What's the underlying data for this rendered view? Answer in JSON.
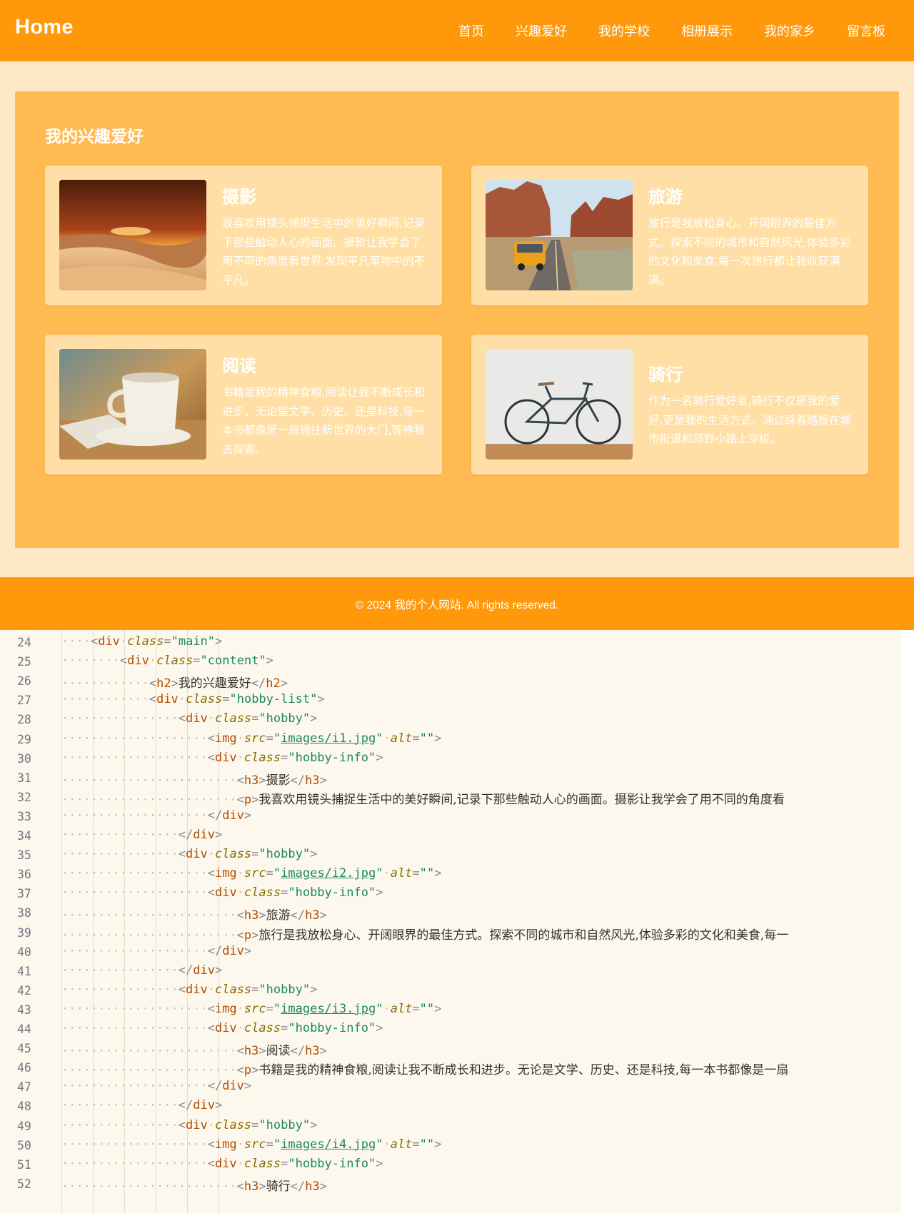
{
  "site": {
    "logo": "Home",
    "nav": [
      "首页",
      "兴趣爱好",
      "我的学校",
      "相册展示",
      "我的家乡",
      "留言板"
    ],
    "section_title": "我的兴趣爱好",
    "hobbies": [
      {
        "title": "摄影",
        "desc": "我喜欢用镜头捕捉生活中的美好瞬间,记录下那些触动人心的画面。摄影让我学会了用不同的角度看世界,发现平凡事物中的不平凡。",
        "image": "desert-sunset-photo"
      },
      {
        "title": "旅游",
        "desc": "旅行是我放松身心、开阔眼界的最佳方式。探索不同的城市和自然风光,体验多彩的文化和美食,每一次旅行都让我收获满满。",
        "image": "canyon-road-van-photo"
      },
      {
        "title": "阅读",
        "desc": "书籍是我的精神食粮,阅读让我不断成长和进步。无论是文学、历史、还是科技,每一本书都像是一扇通往新世界的大门,等待我去探索。",
        "image": "coffee-cup-photo"
      },
      {
        "title": "骑行",
        "desc": "作为一名骑行爱好者,骑行不仅是我的爱好,更是我的生活方式。通过踩着踏板在城市街道和郊野小路上穿梭。",
        "image": "bicycle-wall-photo"
      }
    ],
    "footer": "© 2024 我的个人网站. All rights reserved.",
    "colors": {
      "primary": "#ff980a",
      "panel": "#ffba52",
      "card": "#ffdfa5",
      "background": "#ffe9c4"
    }
  },
  "code": {
    "lines": [
      {
        "n": "24",
        "indent": 1,
        "tokens": [
          [
            "br",
            "<"
          ],
          [
            "tg",
            "div"
          ],
          [
            "ws",
            "·"
          ],
          [
            "at",
            "class"
          ],
          [
            "br",
            "="
          ],
          [
            "st",
            "\"main\""
          ],
          [
            "br",
            ">"
          ]
        ]
      },
      {
        "n": "25",
        "indent": 2,
        "tokens": [
          [
            "br",
            "<"
          ],
          [
            "tg",
            "div"
          ],
          [
            "ws",
            "·"
          ],
          [
            "at",
            "class"
          ],
          [
            "br",
            "="
          ],
          [
            "st",
            "\"content\""
          ],
          [
            "br",
            ">"
          ]
        ]
      },
      {
        "n": "26",
        "indent": 3,
        "tokens": [
          [
            "br",
            "<"
          ],
          [
            "tg",
            "h2"
          ],
          [
            "br",
            ">"
          ],
          [
            "tx",
            "我的兴趣爱好"
          ],
          [
            "br",
            "</"
          ],
          [
            "tg",
            "h2"
          ],
          [
            "br",
            ">"
          ]
        ]
      },
      {
        "n": "27",
        "indent": 3,
        "tokens": [
          [
            "br",
            "<"
          ],
          [
            "tg",
            "div"
          ],
          [
            "ws",
            "·"
          ],
          [
            "at",
            "class"
          ],
          [
            "br",
            "="
          ],
          [
            "st",
            "\"hobby-list\""
          ],
          [
            "br",
            ">"
          ]
        ]
      },
      {
        "n": "28",
        "indent": 4,
        "tokens": [
          [
            "br",
            "<"
          ],
          [
            "tg",
            "div"
          ],
          [
            "ws",
            "·"
          ],
          [
            "at",
            "class"
          ],
          [
            "br",
            "="
          ],
          [
            "st",
            "\"hobby\""
          ],
          [
            "br",
            ">"
          ]
        ]
      },
      {
        "n": "29",
        "indent": 5,
        "tokens": [
          [
            "br",
            "<"
          ],
          [
            "tg",
            "img"
          ],
          [
            "ws",
            "·"
          ],
          [
            "at",
            "src"
          ],
          [
            "br",
            "="
          ],
          [
            "st",
            "\""
          ],
          [
            "lk",
            "images/i1.jpg"
          ],
          [
            "st",
            "\""
          ],
          [
            "ws",
            "·"
          ],
          [
            "at",
            "alt"
          ],
          [
            "br",
            "="
          ],
          [
            "st",
            "\"\""
          ],
          [
            "br",
            ">"
          ]
        ]
      },
      {
        "n": "30",
        "indent": 5,
        "tokens": [
          [
            "br",
            "<"
          ],
          [
            "tg",
            "div"
          ],
          [
            "ws",
            "·"
          ],
          [
            "at",
            "class"
          ],
          [
            "br",
            "="
          ],
          [
            "st",
            "\"hobby-info\""
          ],
          [
            "br",
            ">"
          ]
        ]
      },
      {
        "n": "31",
        "indent": 6,
        "tokens": [
          [
            "br",
            "<"
          ],
          [
            "tg",
            "h3"
          ],
          [
            "br",
            ">"
          ],
          [
            "tx",
            "摄影"
          ],
          [
            "br",
            "</"
          ],
          [
            "tg",
            "h3"
          ],
          [
            "br",
            ">"
          ]
        ]
      },
      {
        "n": "32",
        "indent": 6,
        "tokens": [
          [
            "br",
            "<"
          ],
          [
            "tg",
            "p"
          ],
          [
            "br",
            ">"
          ],
          [
            "tx",
            "我喜欢用镜头捕捉生活中的美好瞬间,记录下那些触动人心的画面。摄影让我学会了用不同的角度看"
          ]
        ]
      },
      {
        "n": "33",
        "indent": 5,
        "tokens": [
          [
            "br",
            "</"
          ],
          [
            "tg",
            "div"
          ],
          [
            "br",
            ">"
          ]
        ]
      },
      {
        "n": "34",
        "indent": 4,
        "tokens": [
          [
            "br",
            "</"
          ],
          [
            "tg",
            "div"
          ],
          [
            "br",
            ">"
          ]
        ]
      },
      {
        "n": "35",
        "indent": 4,
        "tokens": [
          [
            "br",
            "<"
          ],
          [
            "tg",
            "div"
          ],
          [
            "ws",
            "·"
          ],
          [
            "at",
            "class"
          ],
          [
            "br",
            "="
          ],
          [
            "st",
            "\"hobby\""
          ],
          [
            "br",
            ">"
          ]
        ]
      },
      {
        "n": "36",
        "indent": 5,
        "tokens": [
          [
            "br",
            "<"
          ],
          [
            "tg",
            "img"
          ],
          [
            "ws",
            "·"
          ],
          [
            "at",
            "src"
          ],
          [
            "br",
            "="
          ],
          [
            "st",
            "\""
          ],
          [
            "lk",
            "images/i2.jpg"
          ],
          [
            "st",
            "\""
          ],
          [
            "ws",
            "·"
          ],
          [
            "at",
            "alt"
          ],
          [
            "br",
            "="
          ],
          [
            "st",
            "\"\""
          ],
          [
            "br",
            ">"
          ]
        ]
      },
      {
        "n": "37",
        "indent": 5,
        "tokens": [
          [
            "br",
            "<"
          ],
          [
            "tg",
            "div"
          ],
          [
            "ws",
            "·"
          ],
          [
            "at",
            "class"
          ],
          [
            "br",
            "="
          ],
          [
            "st",
            "\"hobby-info\""
          ],
          [
            "br",
            ">"
          ]
        ]
      },
      {
        "n": "38",
        "indent": 6,
        "tokens": [
          [
            "br",
            "<"
          ],
          [
            "tg",
            "h3"
          ],
          [
            "br",
            ">"
          ],
          [
            "tx",
            "旅游"
          ],
          [
            "br",
            "</"
          ],
          [
            "tg",
            "h3"
          ],
          [
            "br",
            ">"
          ]
        ]
      },
      {
        "n": "39",
        "indent": 6,
        "tokens": [
          [
            "br",
            "<"
          ],
          [
            "tg",
            "p"
          ],
          [
            "br",
            ">"
          ],
          [
            "tx",
            "旅行是我放松身心、开阔眼界的最佳方式。探索不同的城市和自然风光,体验多彩的文化和美食,每一"
          ]
        ]
      },
      {
        "n": "40",
        "indent": 5,
        "tokens": [
          [
            "br",
            "</"
          ],
          [
            "tg",
            "div"
          ],
          [
            "br",
            ">"
          ]
        ]
      },
      {
        "n": "41",
        "indent": 4,
        "tokens": [
          [
            "br",
            "</"
          ],
          [
            "tg",
            "div"
          ],
          [
            "br",
            ">"
          ]
        ]
      },
      {
        "n": "42",
        "indent": 4,
        "tokens": [
          [
            "br",
            "<"
          ],
          [
            "tg",
            "div"
          ],
          [
            "ws",
            "·"
          ],
          [
            "at",
            "class"
          ],
          [
            "br",
            "="
          ],
          [
            "st",
            "\"hobby\""
          ],
          [
            "br",
            ">"
          ]
        ]
      },
      {
        "n": "43",
        "indent": 5,
        "tokens": [
          [
            "br",
            "<"
          ],
          [
            "tg",
            "img"
          ],
          [
            "ws",
            "·"
          ],
          [
            "at",
            "src"
          ],
          [
            "br",
            "="
          ],
          [
            "st",
            "\""
          ],
          [
            "lk",
            "images/i3.jpg"
          ],
          [
            "st",
            "\""
          ],
          [
            "ws",
            "·"
          ],
          [
            "at",
            "alt"
          ],
          [
            "br",
            "="
          ],
          [
            "st",
            "\"\""
          ],
          [
            "br",
            ">"
          ]
        ]
      },
      {
        "n": "44",
        "indent": 5,
        "tokens": [
          [
            "br",
            "<"
          ],
          [
            "tg",
            "div"
          ],
          [
            "ws",
            "·"
          ],
          [
            "at",
            "class"
          ],
          [
            "br",
            "="
          ],
          [
            "st",
            "\"hobby-info\""
          ],
          [
            "br",
            ">"
          ]
        ]
      },
      {
        "n": "45",
        "indent": 6,
        "tokens": [
          [
            "br",
            "<"
          ],
          [
            "tg",
            "h3"
          ],
          [
            "br",
            ">"
          ],
          [
            "tx",
            "阅读"
          ],
          [
            "br",
            "</"
          ],
          [
            "tg",
            "h3"
          ],
          [
            "br",
            ">"
          ]
        ]
      },
      {
        "n": "46",
        "indent": 6,
        "tokens": [
          [
            "br",
            "<"
          ],
          [
            "tg",
            "p"
          ],
          [
            "br",
            ">"
          ],
          [
            "tx",
            "书籍是我的精神食粮,阅读让我不断成长和进步。无论是文学、历史、还是科技,每一本书都像是一扇"
          ]
        ]
      },
      {
        "n": "47",
        "indent": 5,
        "tokens": [
          [
            "br",
            "</"
          ],
          [
            "tg",
            "div"
          ],
          [
            "br",
            ">"
          ]
        ]
      },
      {
        "n": "48",
        "indent": 4,
        "tokens": [
          [
            "br",
            "</"
          ],
          [
            "tg",
            "div"
          ],
          [
            "br",
            ">"
          ]
        ]
      },
      {
        "n": "49",
        "indent": 4,
        "tokens": [
          [
            "br",
            "<"
          ],
          [
            "tg",
            "div"
          ],
          [
            "ws",
            "·"
          ],
          [
            "at",
            "class"
          ],
          [
            "br",
            "="
          ],
          [
            "st",
            "\"hobby\""
          ],
          [
            "br",
            ">"
          ]
        ]
      },
      {
        "n": "50",
        "indent": 5,
        "tokens": [
          [
            "br",
            "<"
          ],
          [
            "tg",
            "img"
          ],
          [
            "ws",
            "·"
          ],
          [
            "at",
            "src"
          ],
          [
            "br",
            "="
          ],
          [
            "st",
            "\""
          ],
          [
            "lk",
            "images/i4.jpg"
          ],
          [
            "st",
            "\""
          ],
          [
            "ws",
            "·"
          ],
          [
            "at",
            "alt"
          ],
          [
            "br",
            "="
          ],
          [
            "st",
            "\"\""
          ],
          [
            "br",
            ">"
          ]
        ]
      },
      {
        "n": "51",
        "indent": 5,
        "tokens": [
          [
            "br",
            "<"
          ],
          [
            "tg",
            "div"
          ],
          [
            "ws",
            "·"
          ],
          [
            "at",
            "class"
          ],
          [
            "br",
            "="
          ],
          [
            "st",
            "\"hobby-info\""
          ],
          [
            "br",
            ">"
          ]
        ]
      },
      {
        "n": "52",
        "indent": 6,
        "tokens": [
          [
            "br",
            "<"
          ],
          [
            "tg",
            "h3"
          ],
          [
            "br",
            ">"
          ],
          [
            "tx",
            "骑行"
          ],
          [
            "br",
            "</"
          ],
          [
            "tg",
            "h3"
          ],
          [
            "br",
            ">"
          ]
        ]
      }
    ]
  }
}
